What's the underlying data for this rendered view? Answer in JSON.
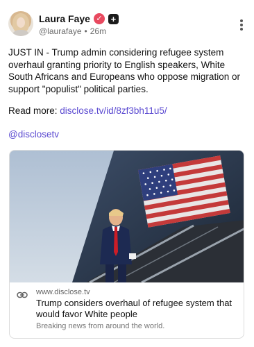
{
  "author": {
    "name": "Laura Faye",
    "verified_badge_icon": "verified-badge-icon",
    "plus_icon": "plus-icon",
    "handle": "@laurafaye",
    "separator": "•",
    "timestamp": "26m"
  },
  "post": {
    "text": "JUST IN - Trump admin considering refugee system overhaul granting priority to English speakers, White South Africans and Europeans who oppose migration or support \"populist\" political parties.",
    "readmore_prefix": "Read more: ",
    "readmore_link": "disclose.tv/id/8zf3bh11u5/",
    "mention": "@disclosetv"
  },
  "card": {
    "domain": "www.disclose.tv",
    "title": "Trump considers overhaul of refugee system that would favor White people",
    "description": "Breaking news from around the world."
  },
  "colors": {
    "link": "#5b4ad1",
    "verified": "#e8495f"
  }
}
